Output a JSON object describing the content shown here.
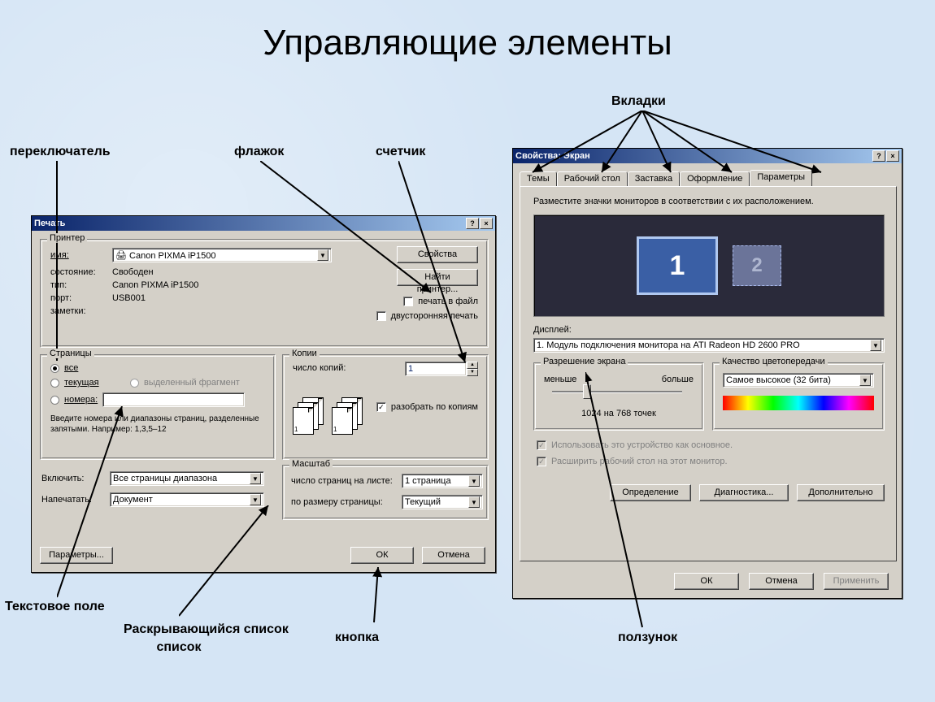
{
  "slide": {
    "title": "Управляющие элементы"
  },
  "labels": {
    "switch": "переключатель",
    "checkbox": "флажок",
    "spinner": "счетчик",
    "tabs": "Вкладки",
    "textfield": "Текстовое поле",
    "dropdown": "Раскрывающийся список",
    "button": "кнопка",
    "slider": "ползунок"
  },
  "print": {
    "title": "Печать",
    "printer_group": "Принтер",
    "name_lbl": "имя:",
    "name_val": "Canon PIXMA iP1500",
    "state_lbl": "состояние:",
    "state_val": "Свободен",
    "type_lbl": "тип:",
    "type_val": "Canon PIXMA iP1500",
    "port_lbl": "порт:",
    "port_val": "USB001",
    "notes_lbl": "заметки:",
    "properties_btn": "Свойства",
    "find_btn": "Найти принтер...",
    "to_file": "печать в файл",
    "duplex": "двусторонняя печать",
    "pages_group": "Страницы",
    "all": "все",
    "current": "текущая",
    "selected": "выделенный фрагмент",
    "numbers": "номера:",
    "hint": "Введите номера или диапазоны страниц, разделенные запятыми. Например: 1,3,5–12",
    "include_lbl": "Включить:",
    "include_val": "Все страницы диапазона",
    "what_lbl": "Напечатать:",
    "what_val": "Документ",
    "copies_group": "Копии",
    "copies_lbl": "число копий:",
    "copies_val": "1",
    "collate": "разобрать по копиям",
    "zoom_group": "Масштаб",
    "pages_per_lbl": "число страниц на листе:",
    "pages_per_val": "1 страница",
    "fit_lbl": "по размеру страницы:",
    "fit_val": "Текущий",
    "params_btn": "Параметры...",
    "ok": "ОК",
    "cancel": "Отмена"
  },
  "display": {
    "title": "Свойства: Экран",
    "tabs": {
      "themes": "Темы",
      "desktop": "Рабочий стол",
      "saver": "Заставка",
      "appearance": "Оформление",
      "settings": "Параметры"
    },
    "instruction": "Разместите значки мониторов в соответствии с их расположением.",
    "mon1": "1",
    "mon2": "2",
    "display_lbl": "Дисплей:",
    "display_val": "1. Модуль подключения монитора на ATI Radeon HD 2600 PRO",
    "res_group": "Разрешение экрана",
    "res_less": "меньше",
    "res_more": "больше",
    "res_val": "1024 на 768 точек",
    "quality_group": "Качество цветопередачи",
    "quality_val": "Самое высокое (32 бита)",
    "use_primary": "Использовать это устройство как основное.",
    "extend": "Расширить рабочий стол на этот монитор.",
    "identify": "Определение",
    "troubleshoot": "Диагностика...",
    "advanced": "Дополнительно",
    "ok": "ОК",
    "cancel": "Отмена",
    "apply": "Применить"
  }
}
